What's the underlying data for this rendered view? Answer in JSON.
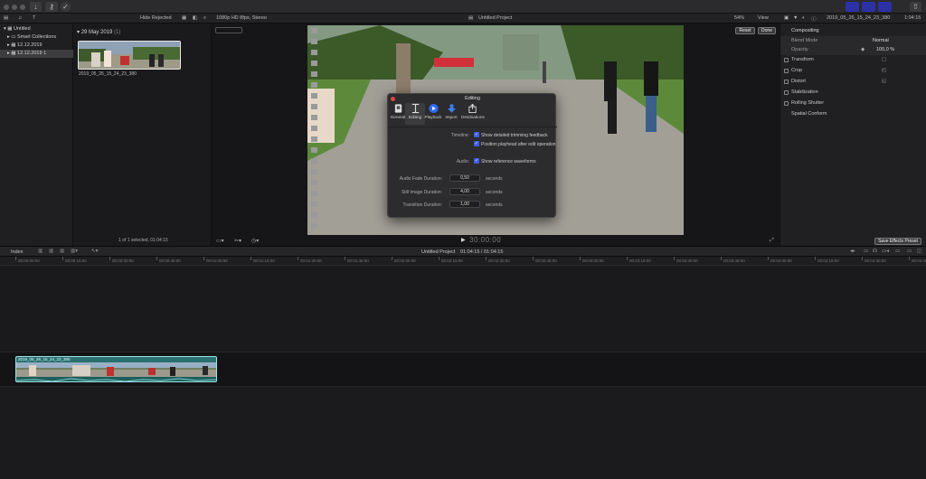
{
  "browser": {
    "hide_rejected": "Hide Rejected",
    "date_header": "29 May 2019",
    "date_count": "(1)",
    "clip_name": "2019_05_26_15_24_23_380",
    "status": "1 of 1 selected, 01:04:15"
  },
  "library": {
    "items": [
      {
        "label": "Untitled"
      },
      {
        "label": "Smart Collections"
      },
      {
        "label": "12.12.2019"
      },
      {
        "label": "12.12.2019 1"
      }
    ]
  },
  "viewer": {
    "format": "1080p HD 8fps, Stereo",
    "project_title": "Untitled Project",
    "zoom": "54%",
    "view_label": "View",
    "timecode": "30:00:00"
  },
  "inspector": {
    "clip_name": "2019_05_26_15_24_23_380",
    "duration": "1:04:15",
    "reset": "Reset",
    "done": "Done",
    "compositing": "Compositing",
    "blend_mode_label": "Blend Mode",
    "blend_mode_value": "Normal",
    "opacity_label": "Opacity",
    "opacity_value": "100,0 %",
    "rows": [
      {
        "label": "Transform"
      },
      {
        "label": "Crop"
      },
      {
        "label": "Distort"
      },
      {
        "label": "Stabilization"
      },
      {
        "label": "Rolling Shutter"
      },
      {
        "label": "Spatial Conform"
      }
    ],
    "save_preset": "Save Effects Preset"
  },
  "timeline": {
    "index_label": "Index",
    "project_name": "Untitled Project",
    "duration": "01:04:15 / 01:04:15",
    "ruler_ticks": [
      "00:00:00:00",
      "00:00:15:00",
      "00:00:30:00",
      "00:00:45:00",
      "00:01:00:00",
      "00:01:15:00",
      "00:01:30:00",
      "00:01:45:00",
      "00:02:00:00",
      "00:02:15:00",
      "00:02:30:00",
      "00:02:45:00",
      "00:03:00:00",
      "00:03:15:00",
      "00:03:30:00",
      "00:03:45:00",
      "00:04:00:00",
      "00:04:15:00",
      "00:04:30:00",
      "00:04:45:00"
    ],
    "clip_label": "2019_05_26_15_24_23_380"
  },
  "prefs": {
    "title": "Editing",
    "tabs": [
      {
        "label": "General",
        "icon": "switch-icon"
      },
      {
        "label": "Editing",
        "icon": "editing-icon"
      },
      {
        "label": "Playback",
        "icon": "play-icon"
      },
      {
        "label": "Import",
        "icon": "import-icon"
      },
      {
        "label": "Destinations",
        "icon": "share-icon"
      }
    ],
    "timeline_label": "Timeline:",
    "opt1": "Show detailed trimming feedback",
    "opt2": "Position playhead after edit operation",
    "audio_label": "Audio:",
    "opt3": "Show reference waveforms",
    "audio_fade_label": "Audio Fade Duration:",
    "audio_fade_value": "0,50",
    "still_label": "Still Image Duration:",
    "still_value": "4,00",
    "transition_label": "Transition Duration:",
    "transition_value": "1,00",
    "seconds": "seconds"
  },
  "colors": {
    "accent": "#3b5de0",
    "clip_border": "#9fe3e3",
    "clip_fill": "#2a7070"
  }
}
